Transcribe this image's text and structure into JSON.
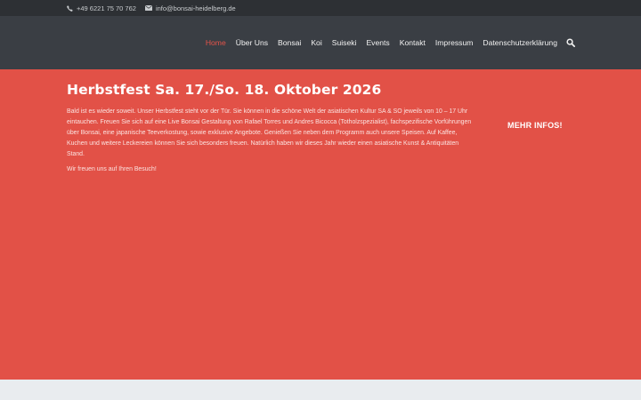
{
  "topbar": {
    "phone": "+49 6221 75 70 762",
    "email": "info@bonsai-heidelberg.de"
  },
  "nav": {
    "items": [
      "Home",
      "Über Uns",
      "Bonsai",
      "Koi",
      "Suiseki",
      "Events",
      "Kontakt",
      "Impressum",
      "Datenschutzerklärung"
    ]
  },
  "hero": {
    "title": "Herbstfest Sa. 17./So. 18. Oktober 2026",
    "paragraph1": "Bald ist es wieder soweit. Unser Herbstfest steht vor der Tür. Sie können in die schöne Welt der asiatischen Kultur SA & SO jeweils von 10 – 17 Uhr eintauchen. Freuen Sie sich auf eine Live Bonsai Gestaltung von Rafael Torres und Andres Bicocca (Totholzspezialist), fachspezifische Vorführungen über Bonsai, eine japanische Teeverkostung, sowie exklusive Angebote. Genießen Sie neben dem Programm auch unsere Speisen. Auf Kaffee, Kuchen und weitere Leckereien können Sie sich besonders freuen. Natürlich haben wir dieses Jahr wieder einen asiatische Kunst & Antiquitäten Stand.",
    "paragraph2": "Wir freuen uns auf Ihren Besuch!",
    "more_label": "MEHR INFOS!"
  },
  "colors": {
    "accent": "#e25147",
    "topbar": "#2d3034",
    "header": "#3a3e44"
  }
}
